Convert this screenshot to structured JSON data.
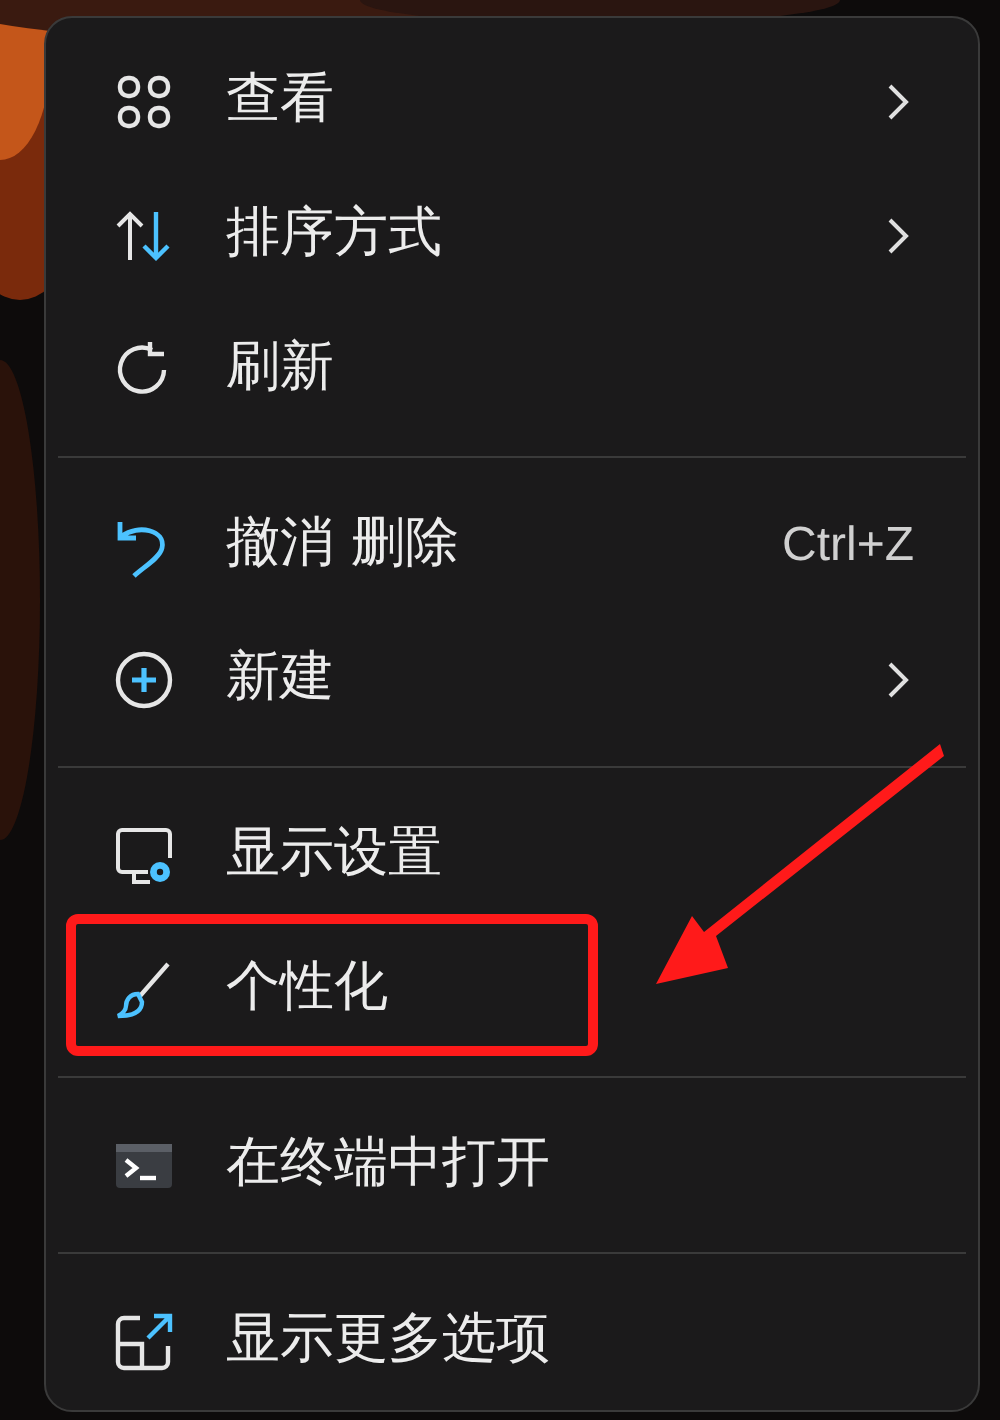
{
  "menu": {
    "groups": [
      {
        "items": [
          {
            "kind": "grid",
            "label": "查看",
            "submenu": true,
            "annotated": false
          },
          {
            "kind": "sort",
            "label": "排序方式",
            "submenu": true,
            "annotated": false
          },
          {
            "kind": "refresh",
            "label": "刷新",
            "submenu": false,
            "annotated": false
          }
        ]
      },
      {
        "items": [
          {
            "kind": "undo",
            "label": "撤消 删除",
            "shortcut": "Ctrl+Z",
            "submenu": false,
            "annotated": false
          },
          {
            "kind": "new",
            "label": "新建",
            "submenu": true,
            "annotated": false
          }
        ]
      },
      {
        "items": [
          {
            "kind": "display",
            "label": "显示设置",
            "submenu": false,
            "annotated": false
          },
          {
            "kind": "brush",
            "label": "个性化",
            "submenu": false,
            "annotated": true
          }
        ]
      },
      {
        "items": [
          {
            "kind": "terminal",
            "label": "在终端中打开",
            "submenu": false,
            "annotated": false
          }
        ]
      },
      {
        "items": [
          {
            "kind": "more",
            "label": "显示更多选项",
            "submenu": false,
            "annotated": false
          }
        ]
      }
    ]
  }
}
